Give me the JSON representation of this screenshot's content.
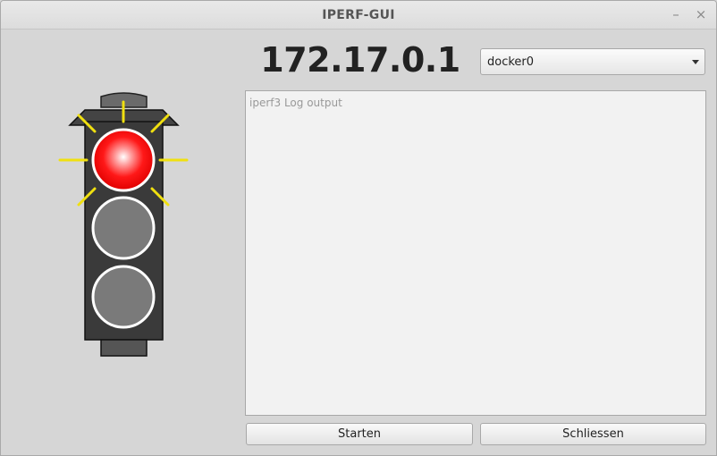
{
  "window": {
    "title": "IPERF-GUI",
    "minimize_label": "–",
    "close_label": "×"
  },
  "header": {
    "ip_address": "172.17.0.1",
    "interface_select": {
      "selected": "docker0"
    }
  },
  "log": {
    "placeholder": "iperf3 Log output",
    "value": ""
  },
  "buttons": {
    "start_label": "Starten",
    "close_label": "Schliessen"
  },
  "traffic_light": {
    "active": "red",
    "colors": {
      "housing": "#3a3a3a",
      "red_on": "#ff1010",
      "lamp_off": "#7a7a7a",
      "glow": "#f0e010"
    }
  }
}
